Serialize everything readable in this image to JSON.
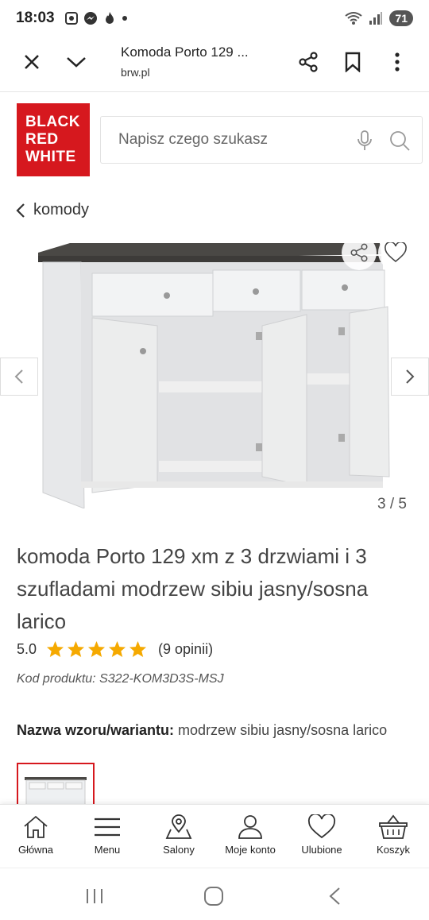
{
  "status": {
    "time": "18:03",
    "battery": "71",
    "icons": [
      "screen-record-icon",
      "messenger-icon",
      "fire-icon",
      "dot-icon",
      "wifi-icon",
      "signal-icon"
    ]
  },
  "browser": {
    "title": "Komoda Porto 129 ...",
    "domain": "brw.pl"
  },
  "header": {
    "logo_lines": [
      "BLACK",
      "RED",
      "WHITE"
    ],
    "search_placeholder": "Napisz czego szukasz"
  },
  "breadcrumb": {
    "label": "komody"
  },
  "gallery": {
    "counter": "3 / 5"
  },
  "product": {
    "title": "komoda Porto 129 xm z 3 drzwiami i 3 szufladami modrzew sibiu jasny/sosna larico",
    "rating_value": "5.0",
    "stars": 5,
    "reviews": "(9 opinii)",
    "code": "Kod produktu: S322-KOM3D3S-MSJ",
    "variant_label": "Nazwa wzoru/wariantu:",
    "variant_value": "modrzew sibiu jasny/sosna larico"
  },
  "bottom_nav": [
    {
      "label": "Główna",
      "icon": "home-icon"
    },
    {
      "label": "Menu",
      "icon": "menu-icon"
    },
    {
      "label": "Salony",
      "icon": "location-icon"
    },
    {
      "label": "Moje konto",
      "icon": "user-icon"
    },
    {
      "label": "Ulubione",
      "icon": "heart-icon"
    },
    {
      "label": "Koszyk",
      "icon": "basket-icon"
    }
  ],
  "colors": {
    "brand": "#d6181e",
    "star": "#f5a900"
  }
}
